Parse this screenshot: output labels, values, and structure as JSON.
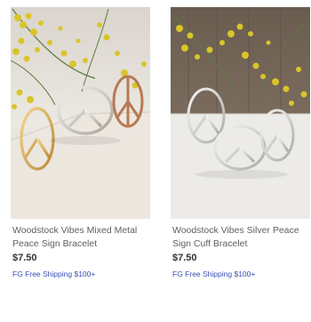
{
  "products": [
    {
      "title": "Woodstock Vibes Mixed Metal Peace Sign Bracelet",
      "price": "$7.50",
      "shipping_label": "FG Free Shipping",
      "shipping_threshold": "$100+",
      "image_icon": "bracelet-photo"
    },
    {
      "title": "Woodstock Vibes Silver Peace Sign Cuff Bracelet",
      "price": "$7.50",
      "shipping_label": "FG Free Shipping",
      "shipping_threshold": "$100+",
      "image_icon": "bracelet-photo"
    }
  ],
  "colors": {
    "title_text": "#5f5f5f",
    "price_text": "#333333",
    "shipping_text": "#3a4fb3"
  }
}
